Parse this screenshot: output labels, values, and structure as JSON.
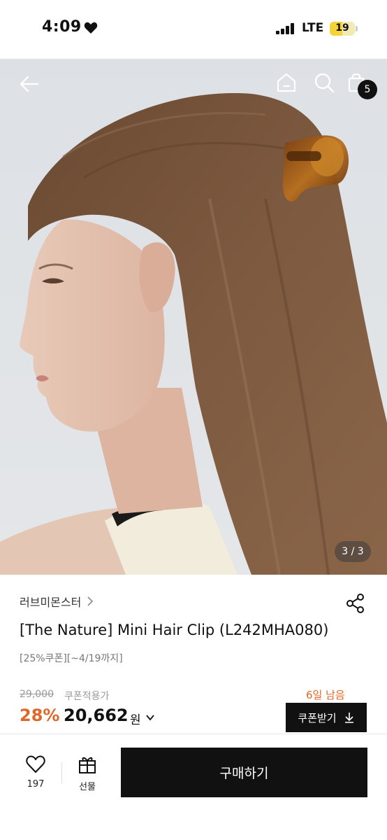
{
  "status_bar": {
    "time": "4:09",
    "network": "LTE",
    "battery_level": "19"
  },
  "nav": {
    "cart_count": "5"
  },
  "hero": {
    "image_counter": "3 / 3"
  },
  "product": {
    "brand": "러브미몬스터",
    "title": "[The Nature] Mini Hair Clip (L242MHA080)",
    "coupon_note": "[25%쿠폰][~4/19까지]",
    "original_price": "29,000",
    "price_note": "쿠폰적용가",
    "days_left": "6일 남음",
    "discount": "28%",
    "sale_price": "20,662",
    "currency": "원",
    "coupon_button": "쿠폰받기"
  },
  "bottom_bar": {
    "like_count": "197",
    "gift_label": "선물",
    "buy_label": "구매하기"
  },
  "colors": {
    "accent": "#e0672a",
    "primary_dark": "#111111"
  },
  "icons": [
    "heart-icon",
    "signal-icon",
    "back-arrow-icon",
    "home-icon",
    "search-icon",
    "shopping-bag-icon",
    "chevron-right-icon",
    "share-icon",
    "chevron-down-icon",
    "download-icon",
    "gift-icon"
  ]
}
